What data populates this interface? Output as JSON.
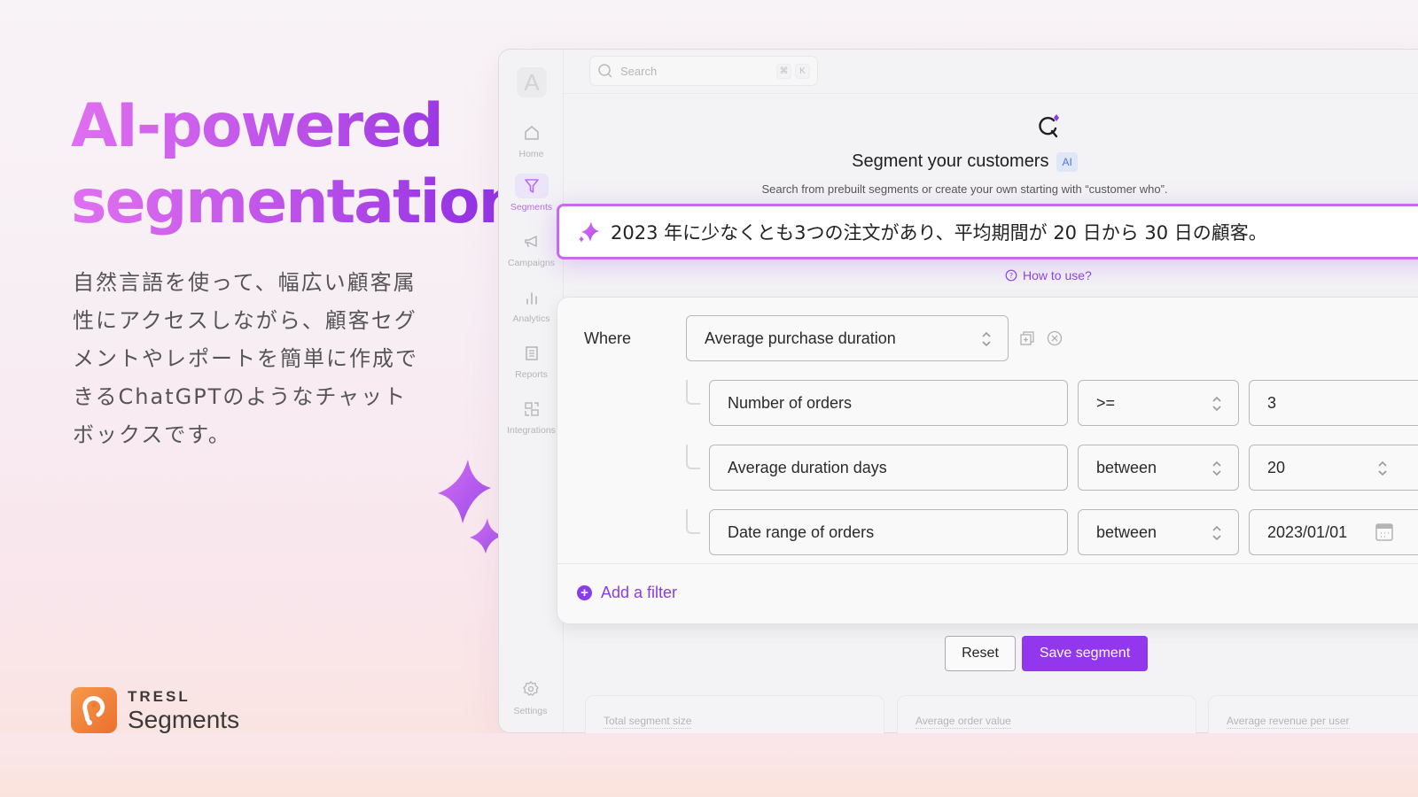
{
  "hero": {
    "title_line1": "AI-powered",
    "title_line2": "segmentation",
    "description": "自然言語を使って、幅広い顧客属性にアクセスしながら、顧客セグメントやレポートを簡単に作成できるChatGPTのようなチャットボックスです。"
  },
  "brand": {
    "company": "TRESL",
    "product": "Segments",
    "logo_color": "#ef7a35"
  },
  "app": {
    "avatar_letter": "A",
    "search": {
      "placeholder": "Search",
      "shortcut_mod": "⌘",
      "shortcut_key": "K"
    },
    "sidebar": {
      "items": [
        {
          "label": "Home",
          "icon": "home-icon",
          "active": false
        },
        {
          "label": "Segments",
          "icon": "filter-icon",
          "active": true
        },
        {
          "label": "Campaigns",
          "icon": "megaphone-icon",
          "active": false
        },
        {
          "label": "Analytics",
          "icon": "bar-chart-icon",
          "active": false
        },
        {
          "label": "Reports",
          "icon": "document-icon",
          "active": false
        },
        {
          "label": "Integrations",
          "icon": "integrations-icon",
          "active": false
        }
      ],
      "settings_label": "Settings"
    },
    "header": {
      "title": "Segment your customers",
      "badge": "AI",
      "subtitle": "Search from prebuilt segments or create your own starting with “customer who”."
    },
    "prompt": {
      "text": "2023 年に少なくとも3つの注文があり、平均期間が 20 日から 30 日の顧客。"
    },
    "how_to_use": "How to use?",
    "filter": {
      "where_label": "Where",
      "main_attribute": "Average purchase duration",
      "conditions": [
        {
          "attribute": "Number of orders",
          "operator": ">=",
          "value": "3"
        },
        {
          "attribute": "Average duration days",
          "operator": "between",
          "value": "20"
        },
        {
          "attribute": "Date range of orders",
          "operator": "between",
          "value": "2023/01/01"
        }
      ],
      "add_filter_label": "Add a filter"
    },
    "buttons": {
      "reset": "Reset",
      "save": "Save segment"
    },
    "stats": [
      {
        "label": "Total segment size"
      },
      {
        "label": "Average order value"
      },
      {
        "label": "Average revenue per user"
      }
    ],
    "accent_color": "#9237ee"
  }
}
